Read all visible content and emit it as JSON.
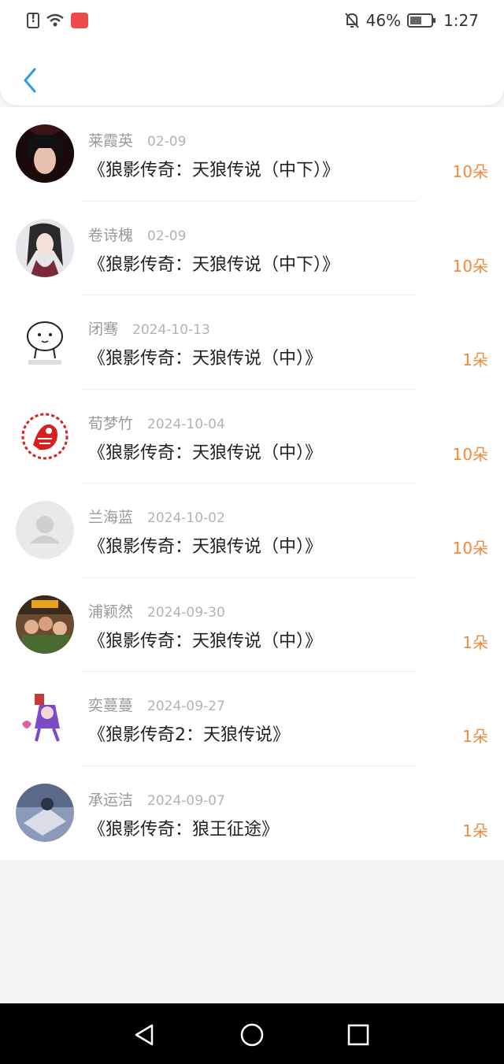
{
  "status_bar": {
    "battery_percent": "46%",
    "time": "1:27",
    "icons": [
      "alert-icon",
      "wifi-icon",
      "app-badge-icon",
      "bell-off-icon",
      "battery-icon"
    ]
  },
  "header": {
    "back_icon": "chevron-left-icon"
  },
  "colors": {
    "accent_blue": "#2f9be3",
    "count_orange": "#f08a3c",
    "name_gray": "#9a9a9a",
    "title_dark": "#222222"
  },
  "gifts": [
    {
      "name": "莱霞英",
      "date": "02-09",
      "title": "《狼影传奇：天狼传说（中下）》",
      "count": "10朵",
      "avatar": "anime-avatar"
    },
    {
      "name": "卷诗槐",
      "date": "02-09",
      "title": "《狼影传奇：天狼传说（中下）》",
      "count": "10朵",
      "avatar": "anime-girl-avatar"
    },
    {
      "name": "闭骞",
      "date": "2024-10-13",
      "title": "《狼影传奇：天狼传说（中）》",
      "count": "1朵",
      "avatar": "cartoon-avatar"
    },
    {
      "name": "荀梦竹",
      "date": "2024-10-04",
      "title": "《狼影传奇：天狼传说（中）》",
      "count": "10朵",
      "avatar": "paper-cut-avatar"
    },
    {
      "name": "兰海蓝",
      "date": "2024-10-02",
      "title": "《狼影传奇：天狼传说（中）》",
      "count": "10朵",
      "avatar": "default-avatar"
    },
    {
      "name": "浦颖然",
      "date": "2024-09-30",
      "title": "《狼影传奇：天狼传说（中）》",
      "count": "1朵",
      "avatar": "photo-avatar"
    },
    {
      "name": "奕蔓蔓",
      "date": "2024-09-27",
      "title": "《狼影传奇2：天狼传说》",
      "count": "1朵",
      "avatar": "cartoon-monster-avatar"
    },
    {
      "name": "承运洁",
      "date": "2024-09-07",
      "title": "《狼影传奇：狼王征途》",
      "count": "1朵",
      "avatar": "photo-avatar"
    }
  ],
  "nav_bar": {
    "icons": [
      "back-triangle-icon",
      "home-circle-icon",
      "recents-square-icon"
    ]
  }
}
